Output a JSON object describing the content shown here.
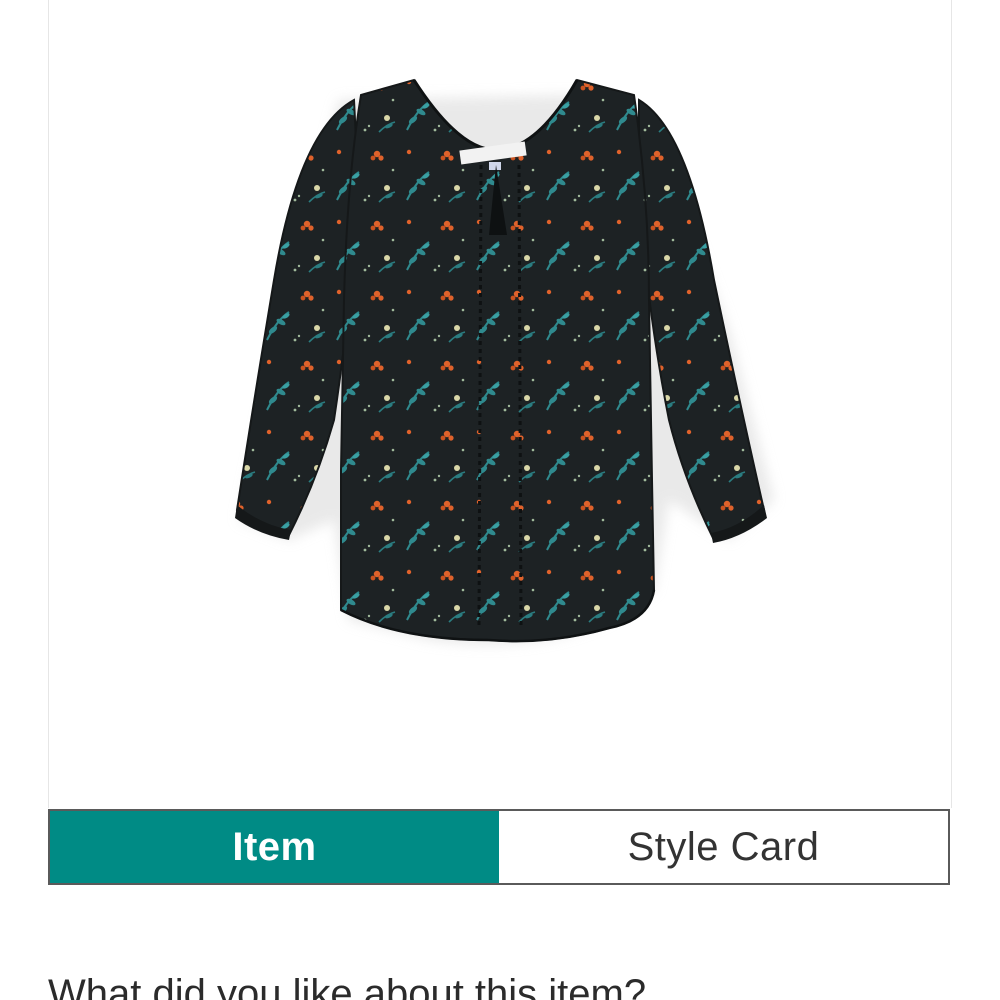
{
  "product": {
    "image_subject": "floral long-sleeve blouse",
    "colors": {
      "fabric": "#1d2224",
      "leaf": "#2f8a8e",
      "flower": "#e0622b",
      "accent": "#d9d7a8"
    }
  },
  "tabs": [
    {
      "label": "Item",
      "active": true
    },
    {
      "label": "Style Card",
      "active": false
    }
  ],
  "feedback": {
    "question": "What did you like about this item?"
  },
  "theme": {
    "accent": "#008b85",
    "border": "#5a5a5a"
  }
}
